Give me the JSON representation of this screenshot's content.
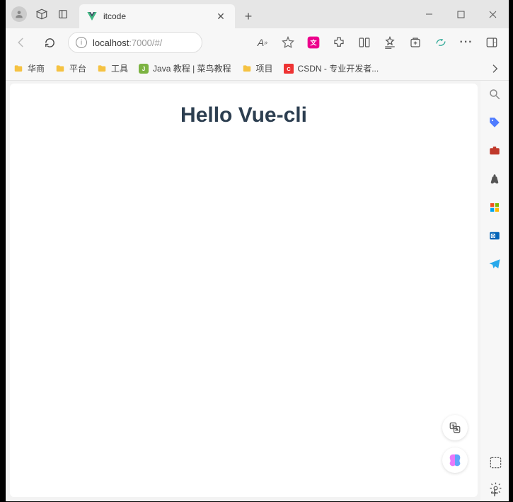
{
  "tab": {
    "title": "itcode"
  },
  "address": {
    "host": "localhost",
    "port_path": ":7000/#/"
  },
  "bookmarks": {
    "items": [
      {
        "label": "华商"
      },
      {
        "label": "平台"
      },
      {
        "label": "工具"
      },
      {
        "label": "Java 教程 | 菜鸟教程"
      },
      {
        "label": "项目"
      },
      {
        "label": "CSDN - 专业开发者..."
      }
    ]
  },
  "page": {
    "heading": "Hello Vue-cli"
  }
}
